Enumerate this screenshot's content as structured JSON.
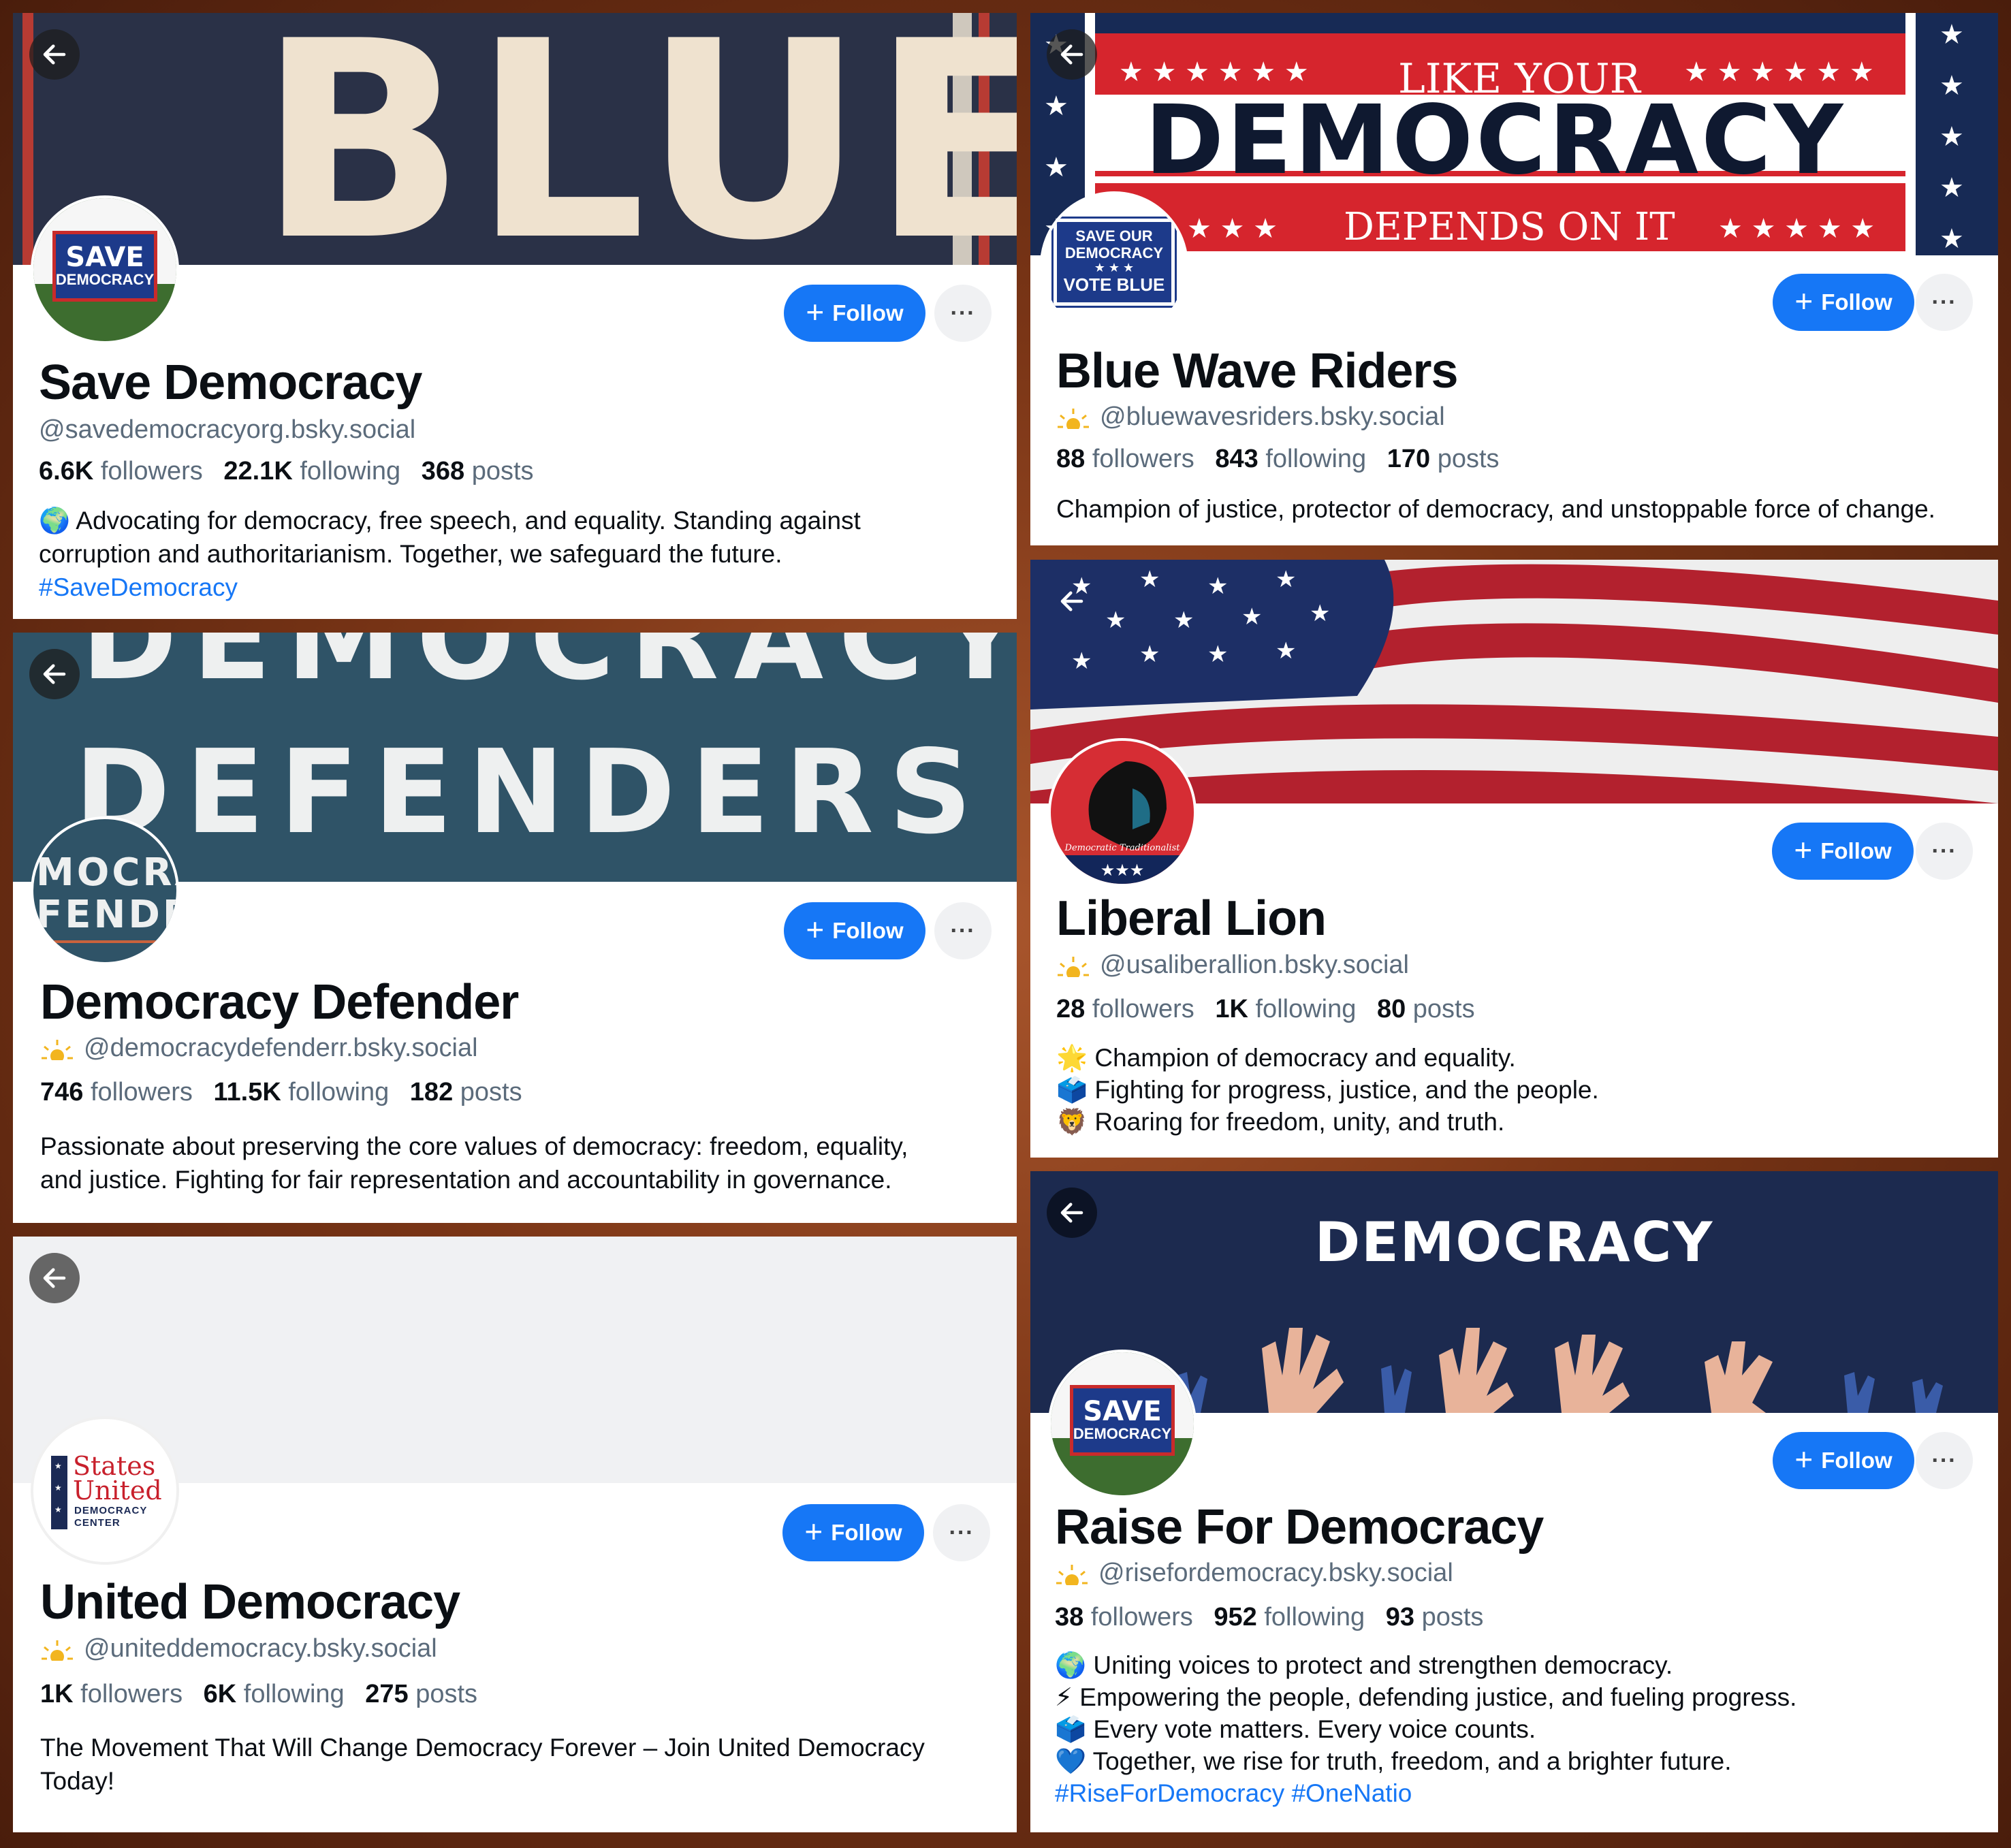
{
  "common": {
    "follow_label": "Follow",
    "more_label": "···",
    "followers_label": "followers",
    "following_label": "following",
    "posts_label": "posts"
  },
  "cards": {
    "c1": {
      "banner_text": "BLUE",
      "avatar_text_1": "SAVE",
      "avatar_text_2": "DEMOCRACY",
      "name": "Save Democracy",
      "handle": "@savedemocracyorg.bsky.social",
      "followers": "6.6K",
      "following": "22.1K",
      "posts": "368",
      "bio_1": "🌍 Advocating for democracy, free speech, and equality. Standing against",
      "bio_2": "corruption and authoritarianism. Together, we safeguard the future.",
      "tag": "#SaveDemocracy"
    },
    "c2": {
      "banner_line_1": "LIKE YOUR",
      "banner_line_2": "DEMOCRACY",
      "banner_line_3": "DEPENDS ON IT",
      "avatar_text_1": "SAVE OUR",
      "avatar_text_2": "DEMOCRACY",
      "avatar_text_3": "VOTE BLUE",
      "name": "Blue Wave Riders",
      "handle": "@bluewavesriders.bsky.social",
      "followers": "88",
      "following": "843",
      "posts": "170",
      "bio_1": "Champion of justice, protector of democracy, and unstoppable force of change."
    },
    "c3": {
      "banner_line_1": "DEMOCRACY",
      "banner_line_2": "DEFENDERS",
      "avatar_text_1": "MOCRA",
      "avatar_text_2": "FENDE",
      "name": "Democracy Defender",
      "handle": "@democracydefenderr.bsky.social",
      "followers": "746",
      "following": "11.5K",
      "posts": "182",
      "bio_1": "Passionate about preserving the core values of democracy: freedom, equality,",
      "bio_2": "and justice. Fighting for fair representation and accountability in governance."
    },
    "c4": {
      "avatar_caption": "Democratic Traditionalist",
      "name": "Liberal Lion",
      "handle": "@usaliberallion.bsky.social",
      "followers": "28",
      "following": "1K",
      "posts": "80",
      "bio_1": "🌟 Champion of democracy and equality.",
      "bio_2": "🗳️ Fighting for progress, justice, and the people.",
      "bio_3": "🦁 Roaring for freedom, unity, and truth."
    },
    "c5": {
      "avatar_text_1": "States",
      "avatar_text_2": "United",
      "avatar_text_3": "DEMOCRACY",
      "avatar_text_4": "CENTER",
      "name": "United Democracy",
      "handle": "@uniteddemocracy.bsky.social",
      "followers": "1K",
      "following": "6K",
      "posts": "275",
      "bio_1": "The Movement That Will Change Democracy Forever – Join United Democracy",
      "bio_2": "Today!"
    },
    "c6": {
      "banner_text": "DEMOCRACY",
      "avatar_text_1": "SAVE",
      "avatar_text_2": "DEMOCRACY",
      "name": "Raise For Democracy",
      "handle": "@risefordemocracy.bsky.social",
      "followers": "38",
      "following": "952",
      "posts": "93",
      "bio_1": "🌍 Uniting voices to protect and strengthen democracy.",
      "bio_2": "⚡ Empowering the people, defending justice, and fueling progress.",
      "bio_3": "🗳️ Every vote matters. Every voice counts.",
      "bio_4": "💙 Together, we rise for truth, freedom, and a brighter future.",
      "tag_1": "#RiseForDemocracy",
      "tag_2": "#OneNatio"
    }
  }
}
